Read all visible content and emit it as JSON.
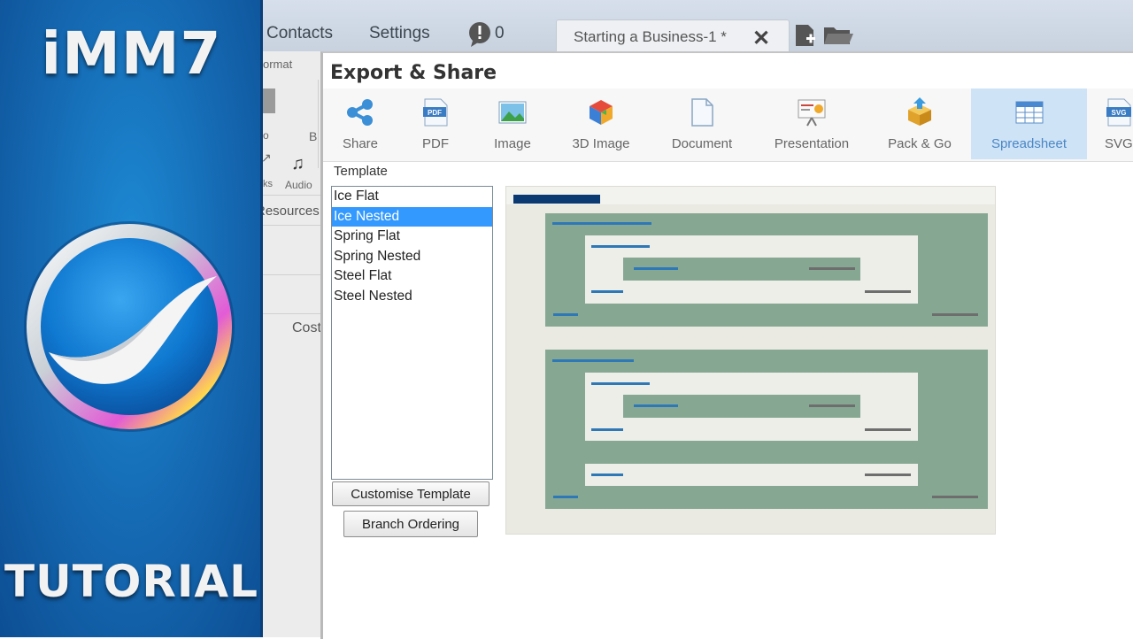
{
  "branding": {
    "title": "iMM7",
    "subtitle": "TUTORIAL"
  },
  "app": {
    "menu": {
      "contacts": "Contacts",
      "settings": "Settings",
      "notification_count": "0"
    },
    "document_tab": {
      "label": "Starting a Business-1 *",
      "close": "✕"
    },
    "left_strip": {
      "format_label": "ormat",
      "letter_o": "o",
      "letter_b": "B",
      "links_label": "ks",
      "audio_label": "Audio",
      "resources_label": "Resources",
      "cost_label": "Cost"
    }
  },
  "dialog": {
    "title": "Export & Share",
    "toolbar": [
      {
        "label": "Share",
        "icon": "share-icon"
      },
      {
        "label": "PDF",
        "icon": "pdf-icon"
      },
      {
        "label": "Image",
        "icon": "image-icon"
      },
      {
        "label": "3D Image",
        "icon": "3d-image-icon"
      },
      {
        "label": "Document",
        "icon": "document-icon"
      },
      {
        "label": "Presentation",
        "icon": "presentation-icon"
      },
      {
        "label": "Pack & Go",
        "icon": "pack-and-go-icon"
      },
      {
        "label": "Spreadsheet",
        "icon": "spreadsheet-icon",
        "active": true
      },
      {
        "label": "SVG",
        "icon": "svg-icon"
      }
    ],
    "icon_text": {
      "pdf": "PDF",
      "svg": "SVG"
    },
    "template_label": "Template",
    "templates": [
      "Ice Flat",
      "Ice Nested",
      "Spring Flat",
      "Spring Nested",
      "Steel Flat",
      "Steel Nested"
    ],
    "selected_template": "Ice Nested",
    "customise_button": "Customise Template",
    "branch_ordering_button": "Branch Ordering",
    "colors": {
      "preview_group": "#86a893",
      "preview_bar_blue": "#2e78b7",
      "preview_header": "#0b3a73",
      "selection": "#3399ff"
    }
  }
}
